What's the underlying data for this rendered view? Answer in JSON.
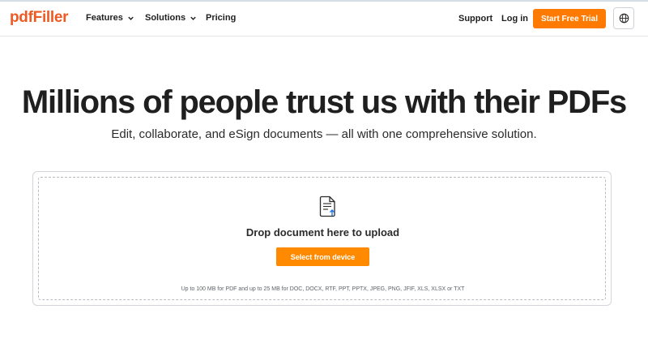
{
  "header": {
    "logo_text": "pdfFiller",
    "nav": [
      {
        "label": "Features",
        "has_dropdown": true,
        "icon": "chevron-down-icon"
      },
      {
        "label": "Solutions",
        "has_dropdown": true,
        "icon": "chevron-down-icon"
      },
      {
        "label": "Pricing",
        "has_dropdown": false
      }
    ],
    "support_label": "Support",
    "login_label": "Log in",
    "cta_label": "Start Free Trial",
    "language_icon": "globe-icon"
  },
  "hero": {
    "title": "Millions of people trust us with their PDFs",
    "subtitle": "Edit, collaborate, and eSign documents — all with one comprehensive solution."
  },
  "upload": {
    "icon": "document-upload-icon",
    "title": "Drop document here to upload",
    "button_label": "Select from device",
    "limits_text": "Up to 100 MB for PDF and up to 25 MB for DOC, DOCX, RTF, PPT, PPTX, JPEG, PNG, JFIF, XLS, XLSX or TXT"
  },
  "colors": {
    "brand": "#ee5a24",
    "cta": "#ff7a00",
    "upload_button": "#ff8a00",
    "accent_blue": "#1a73e8"
  }
}
